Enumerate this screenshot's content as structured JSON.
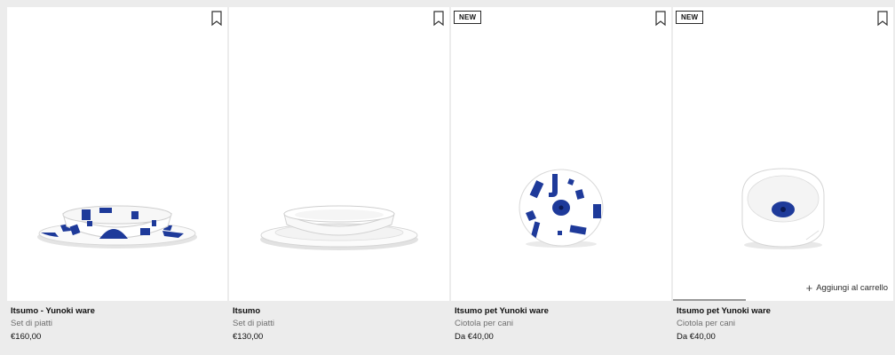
{
  "products": [
    {
      "name": "Itsumo - Yunoki ware",
      "subtitle": "Set di piatti",
      "price": "€160,00",
      "badge": null
    },
    {
      "name": "Itsumo",
      "subtitle": "Set di piatti",
      "price": "€130,00",
      "badge": null
    },
    {
      "name": "Itsumo pet Yunoki ware",
      "subtitle": "Ciotola per cani",
      "price": "Da €40,00",
      "badge": "NEW"
    },
    {
      "name": "Itsumo pet Yunoki ware",
      "subtitle": "Ciotola per cani",
      "price": "Da €40,00",
      "badge": "NEW",
      "add_to_cart": "Aggiungi al carrello"
    }
  ],
  "colors": {
    "pattern_blue": "#1e3a9a",
    "page_bg": "#ececec",
    "tile_bg": "#ffffff"
  },
  "icons": {
    "bookmark": "bookmark-icon",
    "add": "plus-icon"
  }
}
